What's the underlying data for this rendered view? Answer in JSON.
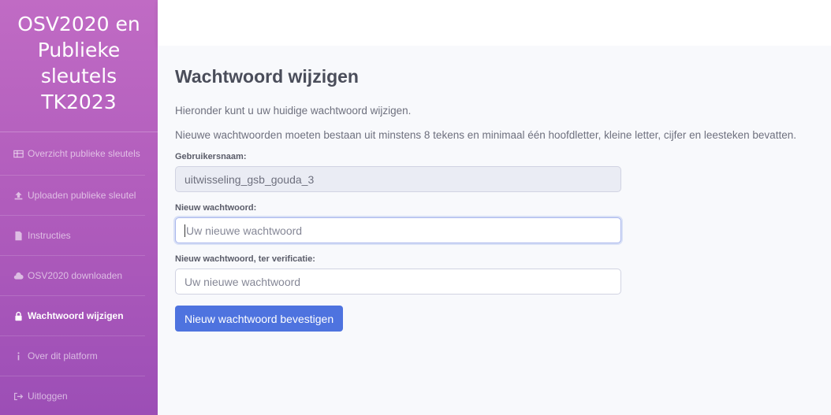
{
  "sidebar": {
    "brand_lines": [
      "OSV2020 en",
      "Publieke",
      "sleutels",
      "TK2023"
    ],
    "items": [
      {
        "label": "Overzicht publieke sleutels",
        "icon": "table-icon"
      },
      {
        "label": "Uploaden publieke sleutel",
        "icon": "upload-icon"
      },
      {
        "label": "Instructies",
        "icon": "file-icon"
      },
      {
        "label": "OSV2020 downloaden",
        "icon": "cloud-icon"
      },
      {
        "label": "Wachtwoord wijzigen",
        "icon": "lock-icon",
        "active": true
      },
      {
        "label": "Over dit platform",
        "icon": "info-icon"
      },
      {
        "label": "Uitloggen",
        "icon": "sign-out-icon"
      }
    ]
  },
  "main": {
    "title": "Wachtwoord wijzigen",
    "intro": "Hieronder kunt u uw huidige wachtwoord wijzigen.",
    "rules": "Nieuwe wachtwoorden moeten bestaan uit minstens 8 tekens en minimaal één hoofdletter, kleine letter, cijfer en leesteken bevatten.",
    "username_label": "Gebruikersnaam:",
    "username_value": "uitwisseling_gsb_gouda_3",
    "new_password_label": "Nieuw wachtwoord:",
    "new_password_placeholder": "Uw nieuwe wachtwoord",
    "verify_password_label": "Nieuw wachtwoord, ter verificatie:",
    "verify_password_placeholder": "Uw nieuwe wachtwoord",
    "submit_label": "Nieuw wachtwoord bevestigen"
  },
  "colors": {
    "sidebar_top": "#c06bc4",
    "sidebar_bottom": "#9c4eb6",
    "primary_button": "#4e73df"
  }
}
